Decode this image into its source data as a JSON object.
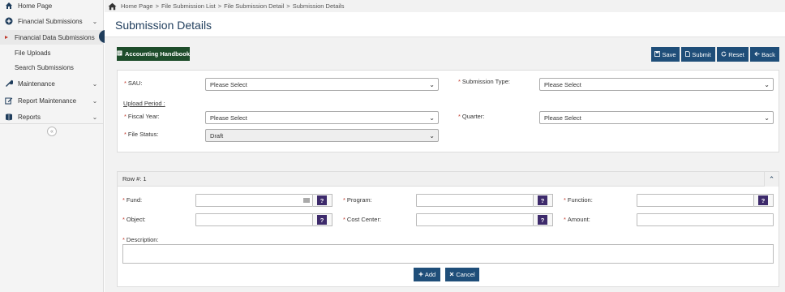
{
  "sidebar": {
    "items": [
      {
        "label": "Home Page",
        "icon": "home-icon"
      },
      {
        "label": "Financial Submissions",
        "icon": "plus-circle-icon",
        "chevron": "⌄"
      },
      {
        "label": "Financial Data Submissions",
        "sub": true,
        "active": true
      },
      {
        "label": "File Uploads",
        "sub": true
      },
      {
        "label": "Search Submissions",
        "sub": true
      },
      {
        "label": "Maintenance",
        "icon": "wrench-icon",
        "chevron": "⌄"
      },
      {
        "label": "Report Maintenance",
        "icon": "edit-icon",
        "chevron": "⌄"
      },
      {
        "label": "Reports",
        "icon": "reports-icon",
        "chevron": "⌄"
      }
    ],
    "collapse_glyph": "«"
  },
  "breadcrumb": {
    "items": [
      "Home Page",
      "File Submission List",
      "File Submission Detail",
      "Submission Details"
    ],
    "separator": ">"
  },
  "page": {
    "title": "Submission Details"
  },
  "toolbar": {
    "handbook_label": "Accounting Handbook",
    "save_label": "Save",
    "submit_label": "Submit",
    "reset_label": "Reset",
    "back_label": "Back"
  },
  "form": {
    "sau_label": "SAU:",
    "sau_value": "Please Select",
    "submission_type_label": "Submission Type:",
    "submission_type_value": "Please Select",
    "upload_period_label": "Upload Period :",
    "fiscal_year_label": "Fiscal Year:",
    "fiscal_year_value": "Please Select",
    "quarter_label": "Quarter:",
    "quarter_value": "Please Select",
    "file_status_label": "File Status:",
    "file_status_value": "Draft",
    "required_mark": "*"
  },
  "row": {
    "header": "Row #: 1",
    "fund_label": "Fund:",
    "program_label": "Program:",
    "function_label": "Function:",
    "object_label": "Object:",
    "cost_center_label": "Cost Center:",
    "amount_label": "Amount:",
    "description_label": "Description:",
    "help_glyph": "?",
    "add_label": "Add",
    "cancel_label": "Cancel"
  },
  "colors": {
    "primary": "#1f4e79",
    "title": "#1f3d5c",
    "handbook": "#1e4d2b",
    "help": "#3d2a6b",
    "required": "#c0392b"
  }
}
